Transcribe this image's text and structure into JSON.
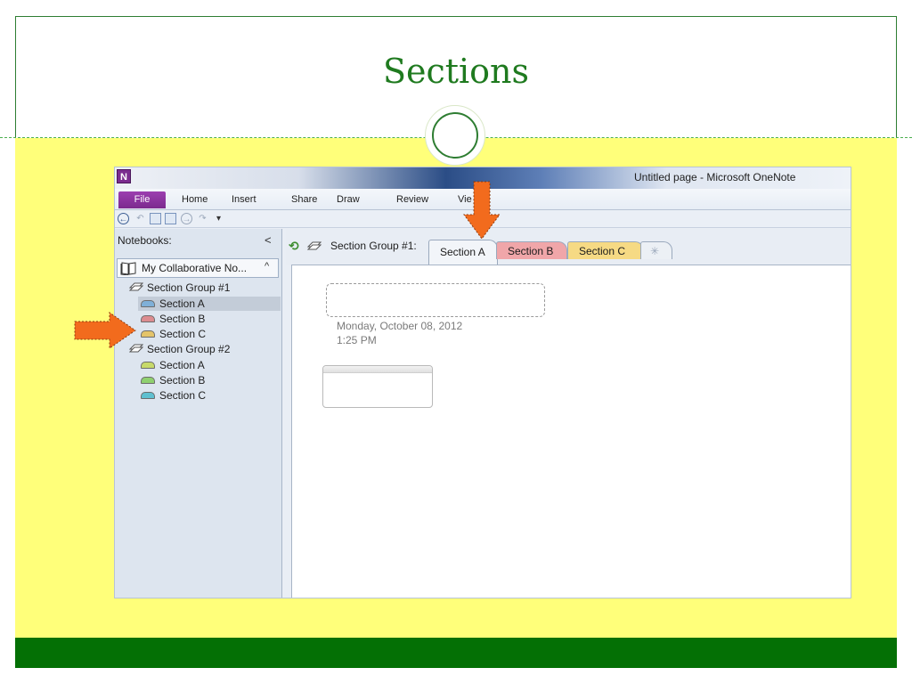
{
  "slide": {
    "title": "Sections",
    "colors": {
      "title": "#1f7a1f",
      "band": "#ffff7a",
      "footer": "#047005"
    }
  },
  "window": {
    "title": "Untitled page - Microsoft OneNote",
    "app_icon": "N",
    "ribbon_tabs": [
      {
        "label": "File"
      },
      {
        "label": "Home"
      },
      {
        "label": "Insert"
      },
      {
        "label": "Share"
      },
      {
        "label": "Draw"
      },
      {
        "label": "Review"
      },
      {
        "label": "Vie"
      }
    ]
  },
  "sidebar": {
    "label": "Notebooks:",
    "collapse": "<",
    "notebook": {
      "name": "My Collaborative No...",
      "chevron": "^"
    },
    "groups": [
      {
        "name": "Section Group #1",
        "sections": [
          {
            "name": "Section A",
            "color": "#7fb0d8",
            "selected": true
          },
          {
            "name": "Section B",
            "color": "#dc8c90"
          },
          {
            "name": "Section C",
            "color": "#e4c46a"
          }
        ]
      },
      {
        "name": "Section Group #2",
        "sections": [
          {
            "name": "Section A",
            "color": "#c7da6a"
          },
          {
            "name": "Section B",
            "color": "#8fd06f"
          },
          {
            "name": "Section C",
            "color": "#5fc0d0"
          }
        ]
      }
    ]
  },
  "tabs": {
    "group_label": "Section Group #1:",
    "sections": [
      {
        "name": "Section A",
        "color": "#f2f5f9",
        "active": true
      },
      {
        "name": "Section B",
        "color": "#f0a6a9"
      },
      {
        "name": "Section C",
        "color": "#f6da84"
      }
    ],
    "new_tab_icon": "new-section-icon"
  },
  "page": {
    "date": "Monday, October 08, 2012",
    "time": "1:25 PM"
  },
  "annotations": {
    "arrow_color": "#f26b1d"
  }
}
